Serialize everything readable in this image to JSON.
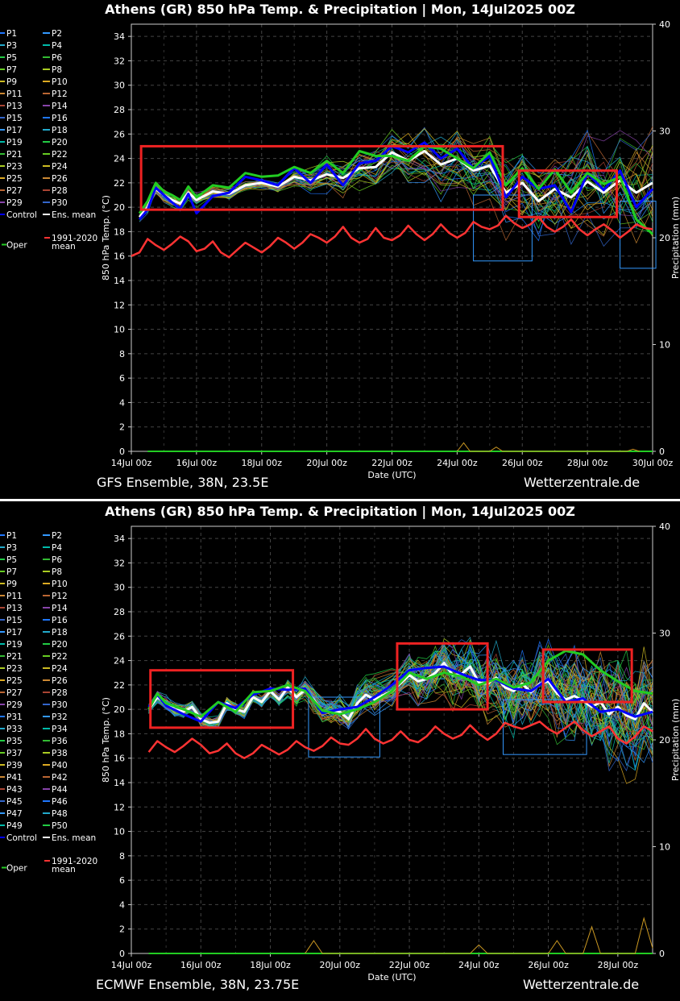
{
  "chart_data": [
    {
      "type": "line",
      "title": "Athens  (GR)  850 hPa Temp. & Precipitation | Mon, 14Jul2025 00Z",
      "ylabel": "850 hPa Temp. (°C)",
      "y2label": "Precipitation (mm)",
      "xlabel": "Date (UTC)",
      "ylim": [
        0,
        35
      ],
      "y2lim": [
        0,
        40
      ],
      "yticks": [
        "0",
        "2",
        "4",
        "6",
        "8",
        "10",
        "12",
        "14",
        "16",
        "18",
        "20",
        "22",
        "24",
        "26",
        "28",
        "30",
        "32",
        "34"
      ],
      "y2ticks": [
        "0",
        "10",
        "20",
        "30",
        "40"
      ],
      "xlim": [
        0,
        16
      ],
      "xticks": [
        "14Jul 00z",
        "16Jul 00z",
        "18Jul 00z",
        "20Jul 00z",
        "22Jul 00z",
        "24Jul 00z",
        "26Jul 00z",
        "28Jul 00z",
        "30Jul 00z"
      ],
      "xtick_days": [
        0,
        2,
        4,
        6,
        8,
        10,
        12,
        14,
        16
      ],
      "grid": true,
      "legend_placement": "left",
      "legend": [
        "P1",
        "P2",
        "P3",
        "P4",
        "P5",
        "P6",
        "P7",
        "P8",
        "P9",
        "P10",
        "P11",
        "P12",
        "P13",
        "P14",
        "P15",
        "P16",
        "P17",
        "P18",
        "P19",
        "P20",
        "P21",
        "P22",
        "P23",
        "P24",
        "P25",
        "P26",
        "P27",
        "P28",
        "P29",
        "P30",
        "Control",
        "Ens. mean",
        "Oper",
        "1991-2020 mean"
      ],
      "members": 30,
      "series": [
        {
          "name": "Ens. mean",
          "color": "#ffffff",
          "x": [
            0.25,
            0.5,
            0.75,
            1,
            1.25,
            1.5,
            1.75,
            2,
            2.5,
            3,
            3.5,
            4,
            4.5,
            5,
            5.5,
            6,
            6.5,
            7,
            7.5,
            8,
            8.5,
            9,
            9.5,
            10,
            10.5,
            11,
            11.5,
            12,
            12.5,
            13,
            13.5,
            14,
            14.5,
            15,
            15.5,
            16
          ],
          "values": [
            19.2,
            20,
            21.5,
            21,
            20.6,
            20.3,
            21.2,
            20.6,
            21.3,
            21.1,
            21.8,
            22,
            21.7,
            22.5,
            22.2,
            22.7,
            22.4,
            23.2,
            23.3,
            24.5,
            23.8,
            24.6,
            23.5,
            24,
            23,
            23.4,
            21.2,
            22,
            20.5,
            21.5,
            20.8,
            22.1,
            21.2,
            22.2,
            21.2,
            22
          ]
        },
        {
          "name": "Control",
          "color": "#0000ff",
          "x": [
            0.25,
            0.5,
            0.75,
            1,
            1.25,
            1.5,
            1.75,
            2,
            2.5,
            3,
            3.5,
            4,
            4.5,
            5,
            5.5,
            6,
            6.5,
            7,
            7.5,
            8,
            8.5,
            9,
            9.5,
            10,
            10.5,
            11,
            11.5,
            12,
            12.5,
            13,
            13.5,
            14,
            14.5,
            15,
            15.5,
            16
          ],
          "values": [
            19,
            19.8,
            21.6,
            21,
            20.4,
            19.9,
            21.1,
            19.5,
            20.9,
            21.2,
            22.5,
            22.2,
            21.8,
            23.2,
            22,
            23.5,
            21.8,
            23.6,
            23.8,
            25,
            24.5,
            25.3,
            24,
            24.8,
            23.2,
            24.2,
            20.8,
            22.5,
            21.5,
            21.8,
            19.6,
            22.8,
            21.4,
            23,
            20,
            21.5
          ]
        },
        {
          "name": "Oper",
          "color": "#22cc22",
          "x": [
            0.25,
            0.5,
            0.75,
            1,
            1.25,
            1.5,
            1.75,
            2,
            2.5,
            3,
            3.5,
            4,
            4.5,
            5,
            5.5,
            6,
            6.5,
            7,
            7.5,
            8,
            8.5,
            9,
            9.5,
            10,
            10.5,
            11,
            11.5,
            12,
            12.5,
            13,
            13.5,
            14,
            14.5,
            15,
            15.5,
            16
          ],
          "values": [
            19.5,
            20.5,
            22,
            21.3,
            21,
            20.6,
            21.7,
            20.8,
            21.8,
            21.6,
            22.8,
            22.5,
            22.6,
            23.3,
            22.8,
            23.8,
            22.8,
            24.6,
            24.2,
            24.2,
            23.8,
            25,
            24.8,
            24,
            23.2,
            24.5,
            21.8,
            23.2,
            21.5,
            23.1,
            21.2,
            22.8,
            21.9,
            22.5,
            19,
            17.8
          ]
        },
        {
          "name": "1991-2020 mean",
          "color": "#ff3333",
          "x": [
            0,
            0.25,
            0.5,
            0.75,
            1,
            1.25,
            1.5,
            1.75,
            2,
            2.25,
            2.5,
            2.75,
            3,
            3.25,
            3.5,
            3.75,
            4,
            4.25,
            4.5,
            4.75,
            5,
            5.25,
            5.5,
            5.75,
            6,
            6.25,
            6.5,
            6.75,
            7,
            7.25,
            7.5,
            7.75,
            8,
            8.25,
            8.5,
            8.75,
            9,
            9.25,
            9.5,
            9.75,
            10,
            10.25,
            10.5,
            10.75,
            11,
            11.25,
            11.5,
            11.75,
            12,
            12.25,
            12.5,
            12.75,
            13,
            13.25,
            13.5,
            13.75,
            14,
            14.25,
            14.5,
            14.75,
            15,
            15.25,
            15.5,
            15.75,
            16
          ],
          "values": [
            16,
            16.3,
            17.4,
            16.9,
            16.5,
            17,
            17.6,
            17.2,
            16.4,
            16.6,
            17.2,
            16.3,
            15.9,
            16.5,
            17.1,
            16.7,
            16.3,
            16.8,
            17.5,
            17.1,
            16.6,
            17.1,
            17.8,
            17.5,
            17.1,
            17.6,
            18.4,
            17.5,
            17.1,
            17.4,
            18.3,
            17.5,
            17.3,
            17.7,
            18.5,
            17.8,
            17.3,
            17.8,
            18.6,
            17.9,
            17.5,
            17.9,
            18.8,
            18.4,
            18.2,
            18.5,
            19.3,
            18.7,
            18.3,
            18.6,
            19.2,
            18.4,
            18.0,
            18.4,
            19.0,
            18.2,
            17.7,
            18.2,
            18.6,
            18.1,
            17.5,
            18.0,
            18.6,
            18.3,
            18.2
          ]
        }
      ],
      "precipitation": {
        "x": [
          10,
          10.2,
          10.4,
          11,
          11.2,
          11.4,
          15.2,
          15.4,
          15.6
        ],
        "values": [
          0,
          0.8,
          0,
          0,
          0.4,
          0,
          0,
          0.2,
          0
        ]
      },
      "spread_seed": 7,
      "highlight_boxes": [
        {
          "x": [
            0.3,
            11.4
          ],
          "y": [
            19.8,
            25
          ]
        },
        {
          "x": [
            11.9,
            14.9
          ],
          "y": [
            19.2,
            23
          ]
        }
      ],
      "blue_boxes": [
        {
          "x": [
            10.5,
            12.3
          ],
          "y": [
            15.6,
            21
          ]
        },
        {
          "x": [
            15,
            16.1
          ],
          "y": [
            15,
            20.5
          ]
        }
      ],
      "footer_left": "GFS Ensemble, 38N, 23.5E",
      "footer_right": "Wetterzentrale.de"
    },
    {
      "type": "line",
      "title": "Athens  (GR)  850 hPa Temp. & Precipitation | Mon, 14Jul2025 00Z",
      "ylabel": "850 hPa Temp. (°C)",
      "y2label": "Precipitation (mm)",
      "xlabel": "Date (UTC)",
      "ylim": [
        0,
        35
      ],
      "y2lim": [
        0,
        40
      ],
      "yticks": [
        "0",
        "2",
        "4",
        "6",
        "8",
        "10",
        "12",
        "14",
        "16",
        "18",
        "20",
        "22",
        "24",
        "26",
        "28",
        "30",
        "32",
        "34"
      ],
      "y2ticks": [
        "0",
        "10",
        "20",
        "30",
        "40"
      ],
      "xlim": [
        0,
        15
      ],
      "xticks": [
        "14Jul 00z",
        "16Jul 00z",
        "18Jul 00z",
        "20Jul 00z",
        "22Jul 00z",
        "24Jul 00z",
        "26Jul 00z",
        "28Jul 00z"
      ],
      "xtick_days": [
        0,
        2,
        4,
        6,
        8,
        10,
        12,
        14
      ],
      "grid": true,
      "legend_placement": "left",
      "legend": [
        "P1",
        "P2",
        "P3",
        "P4",
        "P5",
        "P6",
        "P7",
        "P8",
        "P9",
        "P10",
        "P11",
        "P12",
        "P13",
        "P14",
        "P15",
        "P16",
        "P17",
        "P18",
        "P19",
        "P20",
        "P21",
        "P22",
        "P23",
        "P24",
        "P25",
        "P26",
        "P27",
        "P28",
        "P29",
        "P30",
        "P31",
        "P32",
        "P33",
        "P34",
        "P35",
        "P36",
        "P37",
        "P38",
        "P39",
        "P40",
        "P41",
        "P42",
        "P43",
        "P44",
        "P45",
        "P46",
        "P47",
        "P48",
        "P49",
        "P50",
        "Control",
        "Ens. mean",
        "Oper",
        "1991-2020 mean"
      ],
      "members": 50,
      "series": [
        {
          "name": "Ens. mean",
          "color": "#ffffff",
          "x": [
            0.5,
            0.75,
            1,
            1.25,
            1.5,
            1.75,
            2,
            2.25,
            2.5,
            2.75,
            3,
            3.25,
            3.5,
            3.75,
            4,
            4.25,
            4.5,
            4.75,
            5,
            5.25,
            5.5,
            5.75,
            6,
            6.25,
            6.5,
            6.75,
            7,
            7.5,
            8,
            8.25,
            8.5,
            8.75,
            9,
            9.25,
            9.5,
            9.75,
            10,
            10.25,
            10.5,
            10.75,
            11,
            11.25,
            11.5,
            11.75,
            12,
            12.25,
            12.5,
            12.75,
            13,
            13.25,
            13.5,
            13.75,
            14,
            14.25,
            14.5,
            14.75,
            15
          ],
          "values": [
            20,
            21,
            20.5,
            20,
            19.8,
            20.2,
            19.2,
            18.9,
            19,
            20.5,
            20,
            19.8,
            21,
            20.6,
            21.5,
            20.8,
            21.8,
            21,
            21.6,
            20.8,
            19.8,
            19.8,
            19.8,
            19.2,
            20.5,
            21.2,
            20.8,
            21.5,
            22.8,
            22.3,
            22.5,
            23,
            23.8,
            22.8,
            22.9,
            23.5,
            22.2,
            22.1,
            22.6,
            21.8,
            21.5,
            22.1,
            21.4,
            22.1,
            22.3,
            21.3,
            20.8,
            21.1,
            20.7,
            20.2,
            20.6,
            19.6,
            20.2,
            19.5,
            19.2,
            20.5,
            19.8
          ]
        },
        {
          "name": "Control",
          "color": "#0000ff",
          "x": [
            0.5,
            0.75,
            1,
            1.5,
            2,
            2.5,
            3,
            3.5,
            4,
            4.5,
            5,
            5.5,
            6,
            6.5,
            7,
            7.5,
            8,
            8.5,
            9,
            9.5,
            10,
            10.5,
            11,
            11.5,
            12,
            12.5,
            13,
            13.5,
            14,
            14.5,
            15
          ],
          "values": [
            20.2,
            21.2,
            20.3,
            19.6,
            19,
            20.6,
            20.1,
            21.2,
            21.7,
            21.6,
            21.7,
            19.7,
            20,
            20.2,
            21,
            22,
            23.2,
            23.4,
            23.5,
            22.9,
            22.4,
            22.4,
            21.7,
            21.5,
            22.5,
            20.6,
            20.9,
            19.8,
            20,
            19.4,
            19.8
          ]
        },
        {
          "name": "Oper",
          "color": "#22cc22",
          "x": [
            0.5,
            0.75,
            1,
            1.5,
            2,
            2.5,
            3,
            3.5,
            4,
            4.5,
            5,
            5.5,
            6,
            6.5,
            7,
            7.5,
            8,
            8.5,
            9,
            9.5,
            10,
            10.5,
            11,
            11.5,
            12,
            12.5,
            13,
            13.5,
            14,
            14.5,
            15
          ],
          "values": [
            20,
            21.3,
            20.5,
            20,
            19.4,
            20.6,
            19.8,
            21.4,
            21.5,
            22,
            21.5,
            19.9,
            19.6,
            20,
            20.6,
            21.5,
            23,
            22.5,
            23,
            22.7,
            22,
            22.5,
            21.8,
            22.2,
            24,
            24.8,
            24.5,
            23.2,
            22.3,
            21.5,
            21.3
          ]
        },
        {
          "name": "1991-2020 mean",
          "color": "#ff3333",
          "x": [
            0.5,
            0.75,
            1,
            1.25,
            1.5,
            1.75,
            2,
            2.25,
            2.5,
            2.75,
            3,
            3.25,
            3.5,
            3.75,
            4,
            4.25,
            4.5,
            4.75,
            5,
            5.25,
            5.5,
            5.75,
            6,
            6.25,
            6.5,
            6.75,
            7,
            7.25,
            7.5,
            7.75,
            8,
            8.25,
            8.5,
            8.75,
            9,
            9.25,
            9.5,
            9.75,
            10,
            10.25,
            10.5,
            10.75,
            11,
            11.25,
            11.5,
            11.75,
            12,
            12.25,
            12.5,
            12.75,
            13,
            13.25,
            13.5,
            13.75,
            14,
            14.25,
            14.5,
            14.75,
            15
          ],
          "values": [
            16.5,
            17.4,
            16.9,
            16.5,
            17.0,
            17.6,
            17.1,
            16.4,
            16.6,
            17.2,
            16.4,
            16.0,
            16.4,
            17.1,
            16.7,
            16.3,
            16.7,
            17.4,
            16.9,
            16.6,
            17.0,
            17.7,
            17.2,
            17.1,
            17.6,
            18.4,
            17.6,
            17.2,
            17.5,
            18.2,
            17.5,
            17.3,
            17.8,
            18.6,
            18.0,
            17.6,
            17.9,
            18.7,
            18.0,
            17.5,
            18.0,
            18.9,
            18.6,
            18.4,
            18.7,
            19.0,
            18.4,
            18.0,
            18.5,
            19.0,
            18.3,
            17.8,
            18.2,
            18.6,
            17.6,
            17.2,
            17.8,
            18.6,
            18.2
          ]
        }
      ],
      "precipitation": {
        "x": [
          5,
          5.25,
          5.5,
          9.75,
          10,
          10.25,
          12,
          12.25,
          12.5,
          13,
          13.25,
          13.5,
          14.5,
          14.75,
          15
        ],
        "values": [
          0,
          1.2,
          0,
          0,
          0.8,
          0,
          0,
          1.2,
          0,
          0,
          2.5,
          0,
          0,
          3.3,
          0.5
        ]
      },
      "spread_seed": 11,
      "highlight_boxes": [
        {
          "x": [
            0.55,
            4.65
          ],
          "y": [
            18.5,
            23.2
          ]
        },
        {
          "x": [
            7.65,
            10.25
          ],
          "y": [
            20,
            25.4
          ]
        },
        {
          "x": [
            11.85,
            14.4
          ],
          "y": [
            20.6,
            24.9
          ]
        }
      ],
      "blue_boxes": [
        {
          "x": [
            5.1,
            7.15
          ],
          "y": [
            16.1,
            21
          ]
        },
        {
          "x": [
            10.7,
            13.1
          ],
          "y": [
            16.3,
            20.8
          ]
        }
      ],
      "footer_left": "ECMWF Ensemble, 38N, 23.75E",
      "footer_right": "Wetterzentrale.de"
    }
  ]
}
